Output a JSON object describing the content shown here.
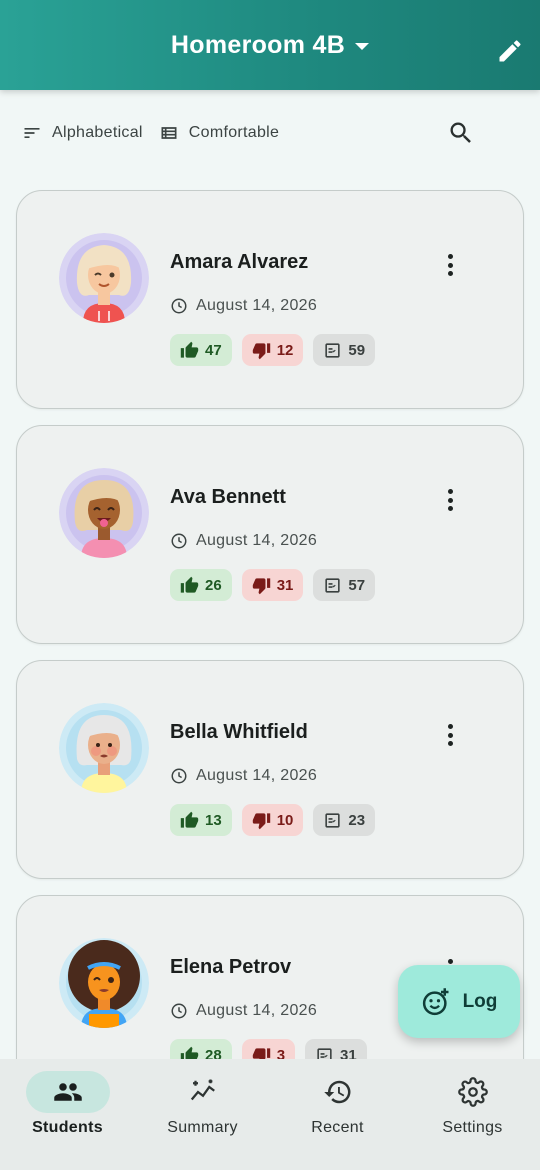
{
  "header": {
    "title": "Homeroom 4B"
  },
  "toolbar": {
    "sort_label": "Alphabetical",
    "density_label": "Comfortable"
  },
  "students": [
    {
      "name": "Amara Alvarez",
      "date": "August 14, 2026",
      "positive": "47",
      "negative": "12",
      "total": "59"
    },
    {
      "name": "Ava Bennett",
      "date": "August 14, 2026",
      "positive": "26",
      "negative": "31",
      "total": "57"
    },
    {
      "name": "Bella Whitfield",
      "date": "August 14, 2026",
      "positive": "13",
      "negative": "10",
      "total": "23"
    },
    {
      "name": "Elena Petrov",
      "date": "August 14, 2026",
      "positive": "28",
      "negative": "3",
      "total": "31"
    }
  ],
  "fab": {
    "label": "Log"
  },
  "nav": {
    "items": [
      {
        "label": "Students",
        "icon": "people-icon"
      },
      {
        "label": "Summary",
        "icon": "sparkle-chart-icon"
      },
      {
        "label": "Recent",
        "icon": "history-icon"
      },
      {
        "label": "Settings",
        "icon": "gear-icon"
      }
    ],
    "active": "Students"
  },
  "colors": {
    "primary": "#1f8a80",
    "fab": "#9eeadb",
    "positive": "#d3ecd5",
    "negative": "#f7d5d3"
  }
}
